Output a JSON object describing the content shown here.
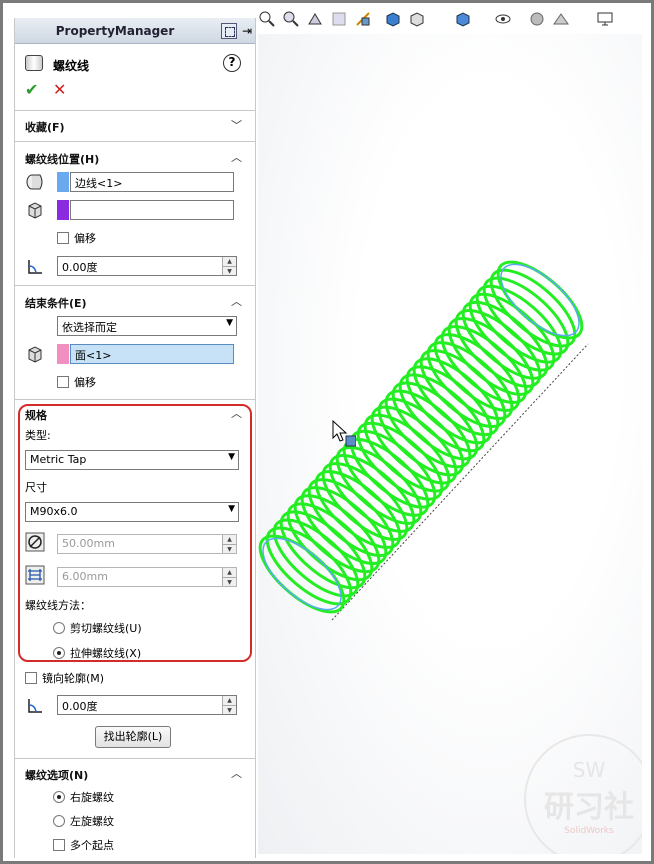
{
  "header": {
    "title": "PropertyManager"
  },
  "feature": {
    "name": "螺纹线",
    "help": "?"
  },
  "actions": {
    "ok": "✔",
    "cancel": "✕"
  },
  "favorites": {
    "title": "收藏(F)"
  },
  "position": {
    "title": "螺纹线位置(H)",
    "edge_value": "边线<1>",
    "face_value": "",
    "offset_label": "偏移",
    "angle_value": "0.00度",
    "edge_color": "#6aa9f0",
    "face_color": "#8a2be2"
  },
  "end_condition": {
    "title": "结束条件(E)",
    "mode": "依选择而定",
    "face_value": "面<1>",
    "offset_label": "偏移",
    "face_color": "#f08fc0"
  },
  "spec": {
    "title": "规格",
    "type_label": "类型:",
    "type_value": "Metric Tap",
    "size_label": "尺寸",
    "size_value": "M90x6.0",
    "diameter_value": "50.00mm",
    "pitch_value": "6.00mm",
    "method_label": "螺纹线方法：",
    "cut_label": "剪切螺纹线(U)",
    "extrude_label": "拉伸螺纹线(X)"
  },
  "profile": {
    "mirror_label": "镜向轮廓(M)",
    "angle_value": "0.00度",
    "locate_button": "找出轮廓(L)"
  },
  "thread_options": {
    "title": "螺纹选项(N)",
    "right_label": "右旋螺纹",
    "left_label": "左旋螺纹",
    "multi_label": "多个起点"
  },
  "watermark": {
    "top": "SW",
    "main": "研习社",
    "sub": "SolidWorks"
  },
  "colors": {
    "thread": "#22ee22",
    "highlight": "#d42a2a"
  }
}
